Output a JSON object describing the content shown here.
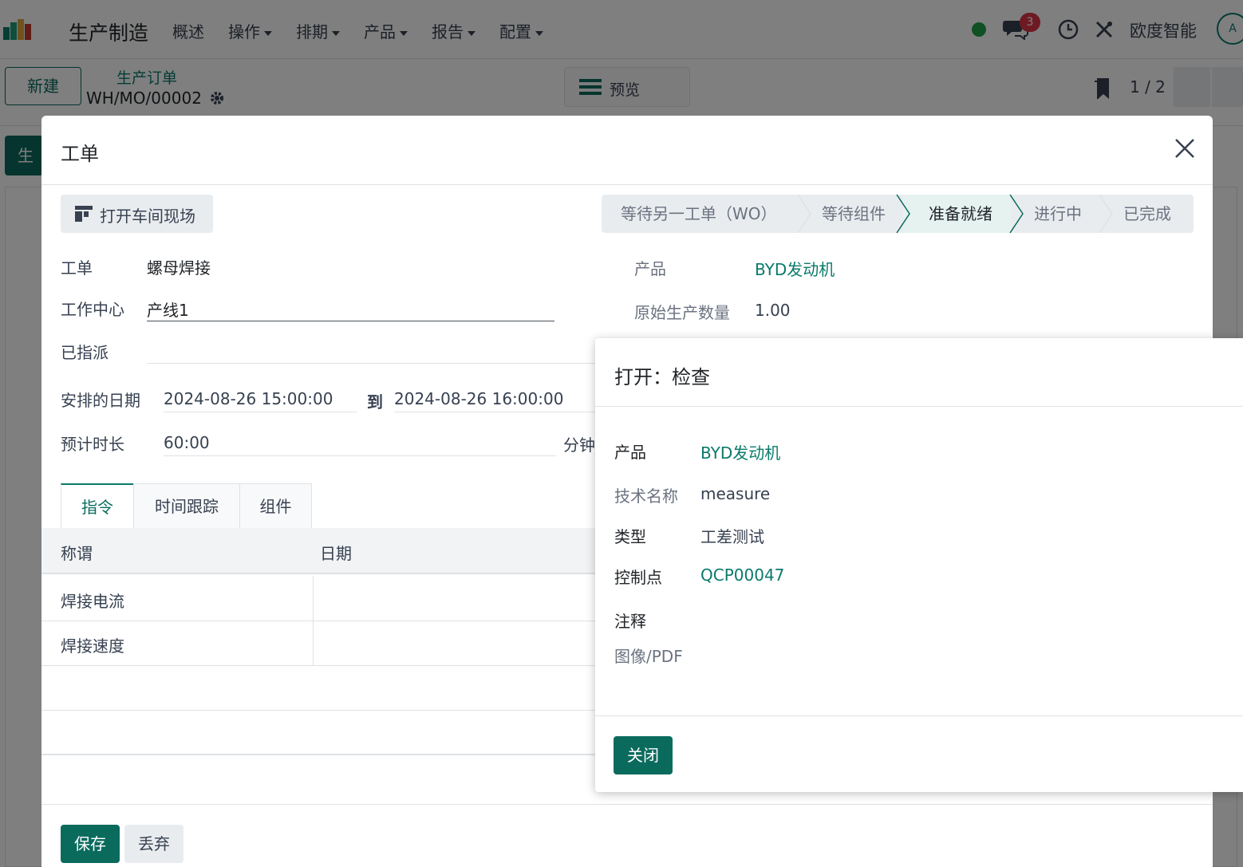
{
  "navbar": {
    "brand": "生产制造",
    "menu": [
      {
        "label": "概述",
        "dropdown": false
      },
      {
        "label": "操作",
        "dropdown": true
      },
      {
        "label": "排期",
        "dropdown": true
      },
      {
        "label": "产品",
        "dropdown": true
      },
      {
        "label": "报告",
        "dropdown": true
      },
      {
        "label": "配置",
        "dropdown": true
      }
    ],
    "chat_badge": "3",
    "company": "欧度智能",
    "avatar_text": "A"
  },
  "control_panel": {
    "new_label": "新建",
    "breadcrumb": "生产订单",
    "record_name": "WH/MO/00002",
    "preview_label": "预览",
    "pager": "1 / 2"
  },
  "background": {
    "tab_partial": "生产"
  },
  "workorder": {
    "title": "工单",
    "open_shopfloor_label": "打开车间现场",
    "stages": [
      "等待另一工单（WO）",
      "等待组件",
      "准备就绪",
      "进行中",
      "已完成"
    ],
    "active_stage": "准备就绪",
    "fields": {
      "workorder_label": "工单",
      "workorder_value": "螺母焊接",
      "workcenter_label": "工作中心",
      "workcenter_value": "产线1",
      "assigned_label": "已指派",
      "assigned_value": "",
      "scheduled_label": "安排的日期",
      "scheduled_from": "2024-08-26 15:00:00",
      "to_label": "到",
      "scheduled_to": "2024-08-26 16:00:00",
      "duration_label": "预计时长",
      "duration_value": "60:00",
      "duration_unit": "分钟",
      "product_label": "产品",
      "product_value": "BYD发动机",
      "orig_qty_label": "原始生产数量",
      "orig_qty_value": "1.00"
    },
    "tabs": [
      "指令",
      "时间跟踪",
      "组件"
    ],
    "table": {
      "columns": [
        "称谓",
        "日期"
      ],
      "rows": [
        "焊接电流",
        "焊接速度"
      ]
    },
    "save_label": "保存",
    "discard_label": "丢弃"
  },
  "check_dialog": {
    "title": "打开：检查",
    "product_label": "产品",
    "product_value": "BYD发动机",
    "tech_name_label": "技术名称",
    "tech_name_value": "measure",
    "type_label": "类型",
    "type_value": "工差测试",
    "control_point_label": "控制点",
    "control_point_value": "QCP00047",
    "note_label": "注释",
    "image_label": "图像/PDF",
    "close_label": "关闭"
  },
  "colors": {
    "primary": "#0a6b5d",
    "link": "#0a7a6b",
    "badge": "#dc3545",
    "online": "#22a046"
  }
}
